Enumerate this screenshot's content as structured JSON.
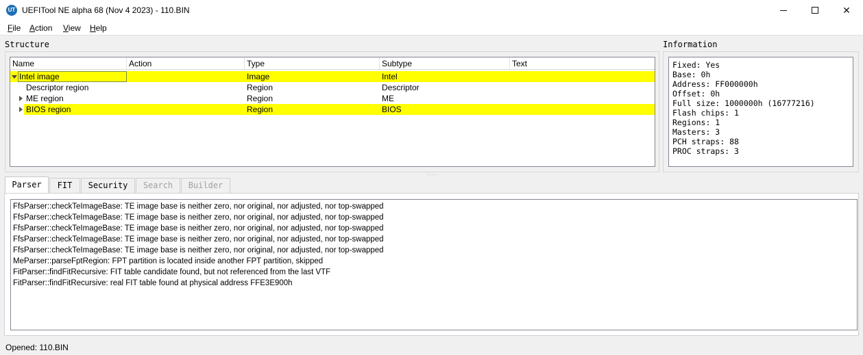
{
  "window": {
    "title": "UEFITool NE alpha 68 (Nov  4 2023) - 110.BIN",
    "app_icon_text": "UT",
    "minimize_icon": "minimize-icon",
    "maximize_icon": "maximize-icon",
    "close_icon": "close-icon",
    "close_glyph": "✕"
  },
  "menu": {
    "items": [
      {
        "label": "File",
        "mnemonic": "F",
        "rest": "ile"
      },
      {
        "label": "Action",
        "mnemonic": "A",
        "rest": "ction"
      },
      {
        "label": "View",
        "mnemonic": "V",
        "rest": "iew"
      },
      {
        "label": "Help",
        "mnemonic": "H",
        "rest": "elp"
      }
    ]
  },
  "structure": {
    "label": "Structure",
    "columns": [
      "Name",
      "Action",
      "Type",
      "Subtype",
      "Text"
    ],
    "rows": [
      {
        "name": "Intel image",
        "action": "",
        "type": "Image",
        "subtype": "Intel",
        "text": "",
        "highlight": true,
        "expander": "expanded",
        "selected": true
      },
      {
        "name": "Descriptor region",
        "action": "",
        "type": "Region",
        "subtype": "Descriptor",
        "text": "",
        "highlight": false,
        "expander": "none"
      },
      {
        "name": "ME region",
        "action": "",
        "type": "Region",
        "subtype": "ME",
        "text": "",
        "highlight": false,
        "expander": "collapsed"
      },
      {
        "name": "BIOS region",
        "action": "",
        "type": "Region",
        "subtype": "BIOS",
        "text": "",
        "highlight": true,
        "expander": "collapsed"
      }
    ],
    "highlight_color": "#ffff00"
  },
  "information": {
    "label": "Information",
    "lines": [
      "Fixed: Yes",
      "Base: 0h",
      "Address: FF000000h",
      "Offset: 0h",
      "Full size: 1000000h (16777216)",
      "Flash chips: 1",
      "Regions: 1",
      "Masters: 3",
      "PCH straps: 88",
      "PROC straps: 3"
    ]
  },
  "tabs": [
    {
      "label": "Parser",
      "active": true,
      "disabled": false
    },
    {
      "label": "FIT",
      "active": false,
      "disabled": false
    },
    {
      "label": "Security",
      "active": false,
      "disabled": false
    },
    {
      "label": "Search",
      "active": false,
      "disabled": true
    },
    {
      "label": "Builder",
      "active": false,
      "disabled": true
    }
  ],
  "messages": [
    "FfsParser::checkTeImageBase: TE image base is neither zero, nor original, nor adjusted, nor top-swapped",
    "FfsParser::checkTeImageBase: TE image base is neither zero, nor original, nor adjusted, nor top-swapped",
    "FfsParser::checkTeImageBase: TE image base is neither zero, nor original, nor adjusted, nor top-swapped",
    "FfsParser::checkTeImageBase: TE image base is neither zero, nor original, nor adjusted, nor top-swapped",
    "FfsParser::checkTeImageBase: TE image base is neither zero, nor original, nor adjusted, nor top-swapped",
    "MeParser::parseFptRegion: FPT partition is located inside another FPT partition, skipped",
    "FitParser::findFitRecursive: FIT table candidate found, but not referenced from the last VTF",
    "FitParser::findFitRecursive: real FIT table found at physical address FFE3E900h"
  ],
  "status": {
    "text": "Opened: 110.BIN"
  }
}
